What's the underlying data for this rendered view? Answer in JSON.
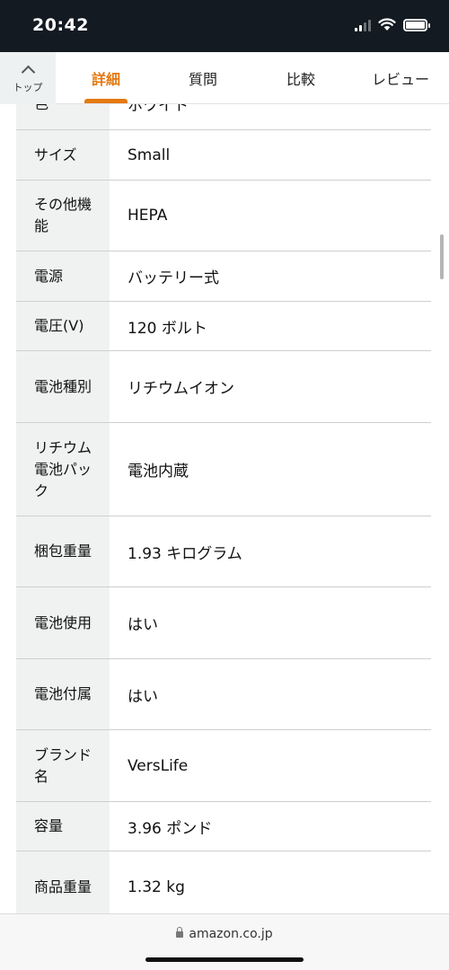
{
  "status_bar": {
    "time": "20:42",
    "icons": [
      "cellular-signal-icon",
      "wifi-icon",
      "battery-icon"
    ]
  },
  "tabs": {
    "top_label": "トップ",
    "items": [
      {
        "label": "詳細",
        "active": true
      },
      {
        "label": "質問",
        "active": false
      },
      {
        "label": "比較",
        "active": false
      },
      {
        "label": "レビュー",
        "active": false
      }
    ]
  },
  "specs": [
    {
      "key": "色",
      "value": "ホワイト"
    },
    {
      "key": "サイズ",
      "value": "Small"
    },
    {
      "key": "その他機能",
      "value": "HEPA"
    },
    {
      "key": "電源",
      "value": "バッテリー式"
    },
    {
      "key": "電圧(V)",
      "value": "120 ボルト"
    },
    {
      "key": "電池種別",
      "value": "リチウムイオン"
    },
    {
      "key": "リチウム電池パック",
      "value": "電池内蔵"
    },
    {
      "key": "梱包重量",
      "value": "1.93 キログラム"
    },
    {
      "key": "電池使用",
      "value": "はい"
    },
    {
      "key": "電池付属",
      "value": "はい"
    },
    {
      "key": "ブランド名",
      "value": "VersLife"
    },
    {
      "key": "容量",
      "value": "3.96 ポンド"
    },
    {
      "key": "商品重量",
      "value": "1.32 kg"
    }
  ],
  "browser": {
    "url": "amazon.co.jp"
  },
  "colors": {
    "accent": "#e47911",
    "status_bar_bg": "#131a22",
    "key_cell_bg": "#f0f2f2"
  }
}
